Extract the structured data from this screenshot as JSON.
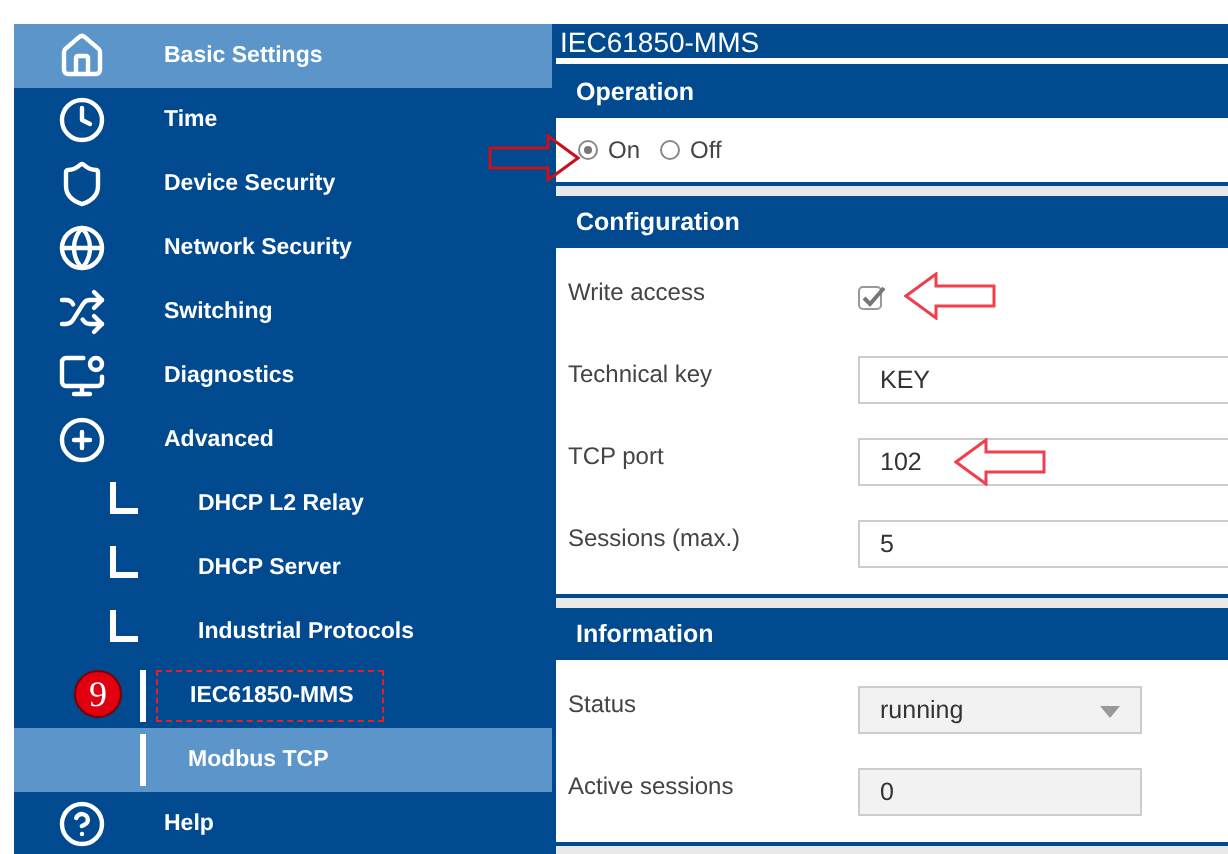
{
  "sidebar": {
    "items": [
      {
        "label": "Basic Settings",
        "selected": true
      },
      {
        "label": "Time",
        "selected": false
      },
      {
        "label": "Device Security",
        "selected": false
      },
      {
        "label": "Network Security",
        "selected": false
      },
      {
        "label": "Switching",
        "selected": false
      },
      {
        "label": "Diagnostics",
        "selected": false
      },
      {
        "label": "Advanced",
        "selected": false,
        "children": [
          {
            "label": "DHCP L2 Relay",
            "selected": false
          },
          {
            "label": "DHCP Server",
            "selected": false
          },
          {
            "label": "Industrial Protocols",
            "selected": false,
            "children": [
              {
                "label": "IEC61850-MMS",
                "selected": false,
                "highlighted": true,
                "badge": "9"
              },
              {
                "label": "Modbus TCP",
                "selected": true,
                "highlighted": false
              }
            ]
          }
        ]
      },
      {
        "label": "Help",
        "selected": false
      }
    ]
  },
  "panel": {
    "title": "IEC61850-MMS",
    "sections": [
      {
        "title": "Operation",
        "kind": "radios",
        "options": [
          {
            "label": "On",
            "selected": true
          },
          {
            "label": "Off",
            "selected": false
          }
        ]
      },
      {
        "title": "Configuration",
        "kind": "fields",
        "rows": [
          {
            "label": "Write access",
            "kind": "checkbox",
            "checked": true
          },
          {
            "label": "Technical key",
            "kind": "input",
            "value": "KEY"
          },
          {
            "label": "TCP port",
            "kind": "input",
            "value": "102"
          },
          {
            "label": "Sessions (max.)",
            "kind": "input",
            "value": "5"
          }
        ]
      },
      {
        "title": "Information",
        "kind": "fields",
        "rows": [
          {
            "label": "Status",
            "kind": "select",
            "value": "running"
          },
          {
            "label": "Active sessions",
            "kind": "readonly",
            "value": "0"
          }
        ]
      }
    ]
  }
}
